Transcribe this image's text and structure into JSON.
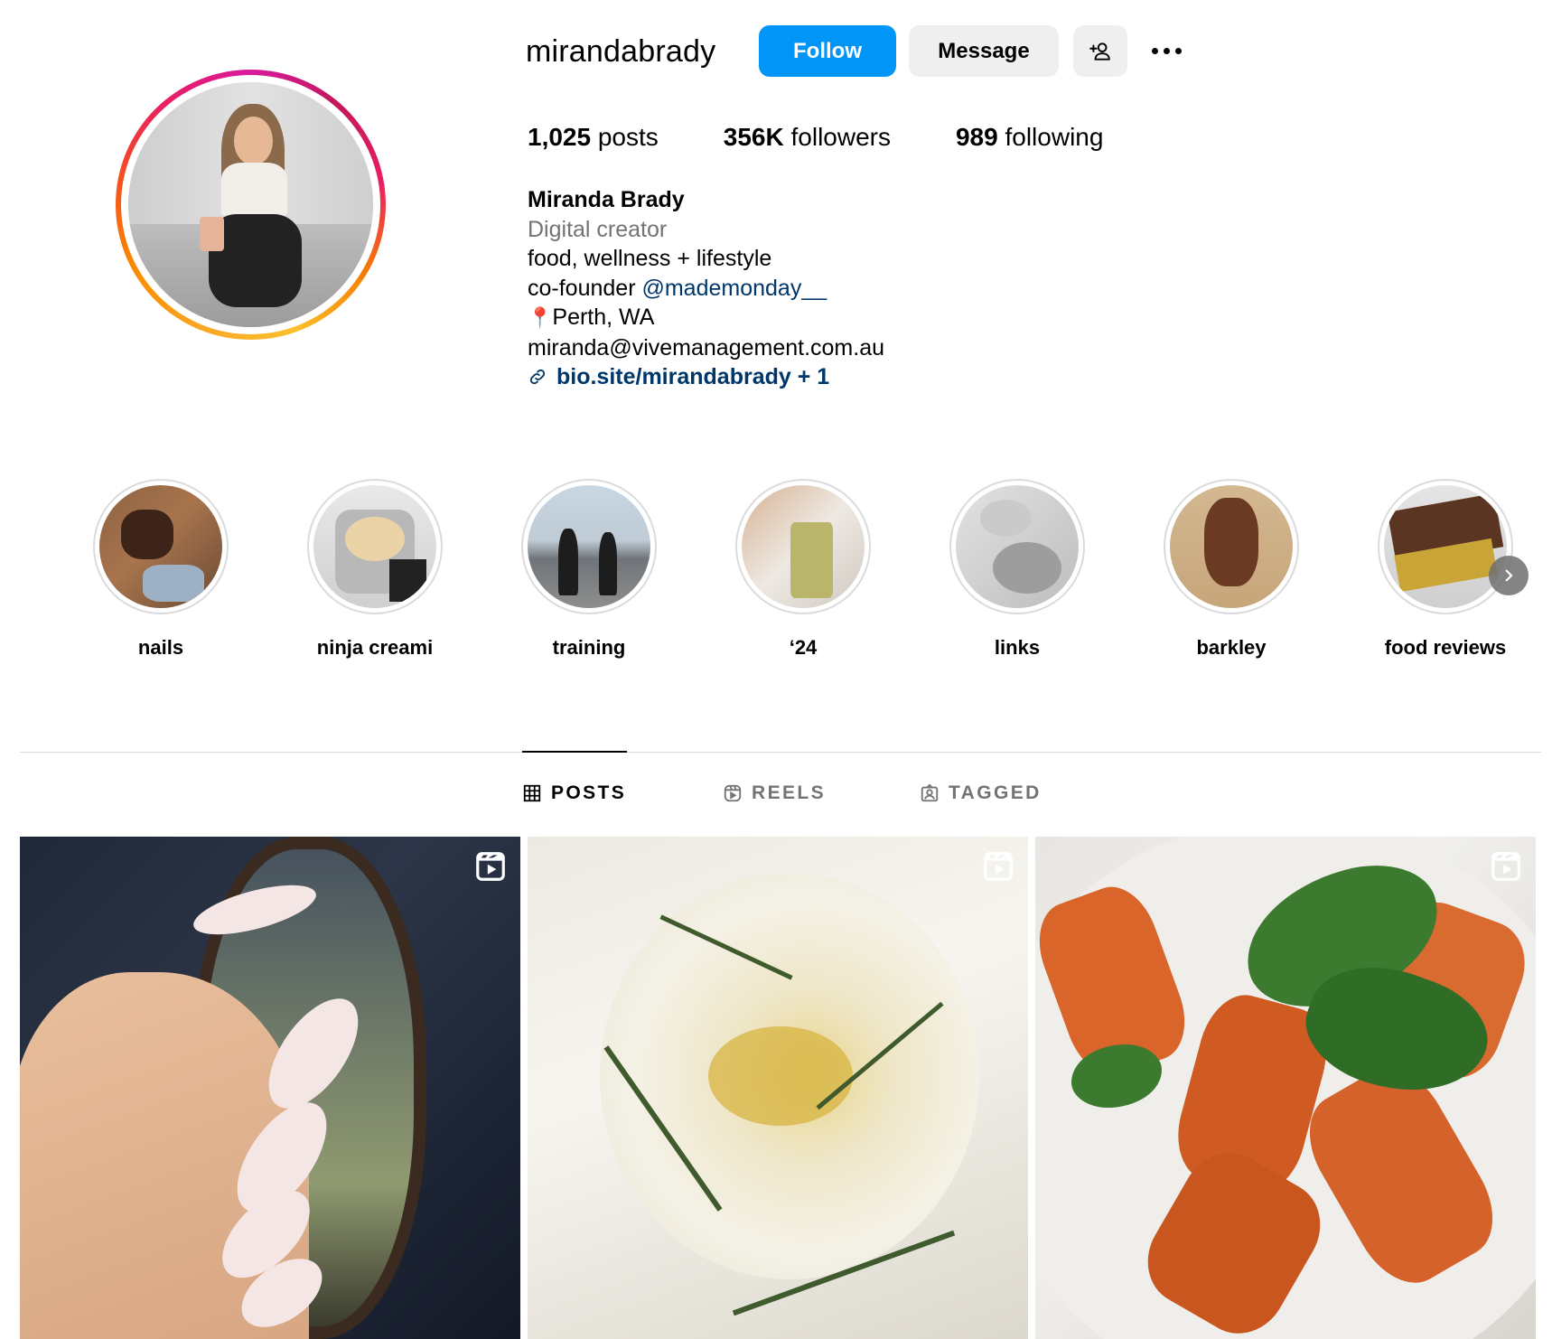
{
  "profile": {
    "username": "mirandabrady",
    "follow_label": "Follow",
    "message_label": "Message",
    "stats": {
      "posts_count": "1,025",
      "posts_label": " posts",
      "followers_count": "356K",
      "followers_label": " followers",
      "following_count": "989",
      "following_label": " following"
    },
    "bio": {
      "name": "Miranda Brady",
      "category": "Digital creator",
      "line1": "food, wellness + lifestyle",
      "line2_prefix": "co-founder ",
      "line2_mention": "@mademonday__",
      "location_icon": "📍",
      "location": "Perth, WA",
      "email": "miranda@vivemanagement.com.au",
      "link": "bio.site/mirandabrady + 1"
    }
  },
  "highlights": [
    {
      "label": "nails"
    },
    {
      "label": "ninja creami"
    },
    {
      "label": "training"
    },
    {
      "label": "‘24"
    },
    {
      "label": "links"
    },
    {
      "label": "barkley"
    },
    {
      "label": "food reviews"
    }
  ],
  "tabs": {
    "posts": "POSTS",
    "reels": "REELS",
    "tagged": "TAGGED",
    "active": "posts"
  },
  "colors": {
    "accent": "#0095f6",
    "button_gray": "#efefef",
    "secondary_text": "#737373",
    "link": "#00376b",
    "divider": "#dbdbdb"
  },
  "icons": {
    "add_user": "person-plus-icon",
    "more": "more-options-icon",
    "link": "link-icon",
    "posts_tab": "grid-icon",
    "reels_tab": "reels-icon",
    "tagged_tab": "tagged-user-icon",
    "reel_badge": "reel-badge-icon",
    "next": "chevron-right-icon"
  }
}
